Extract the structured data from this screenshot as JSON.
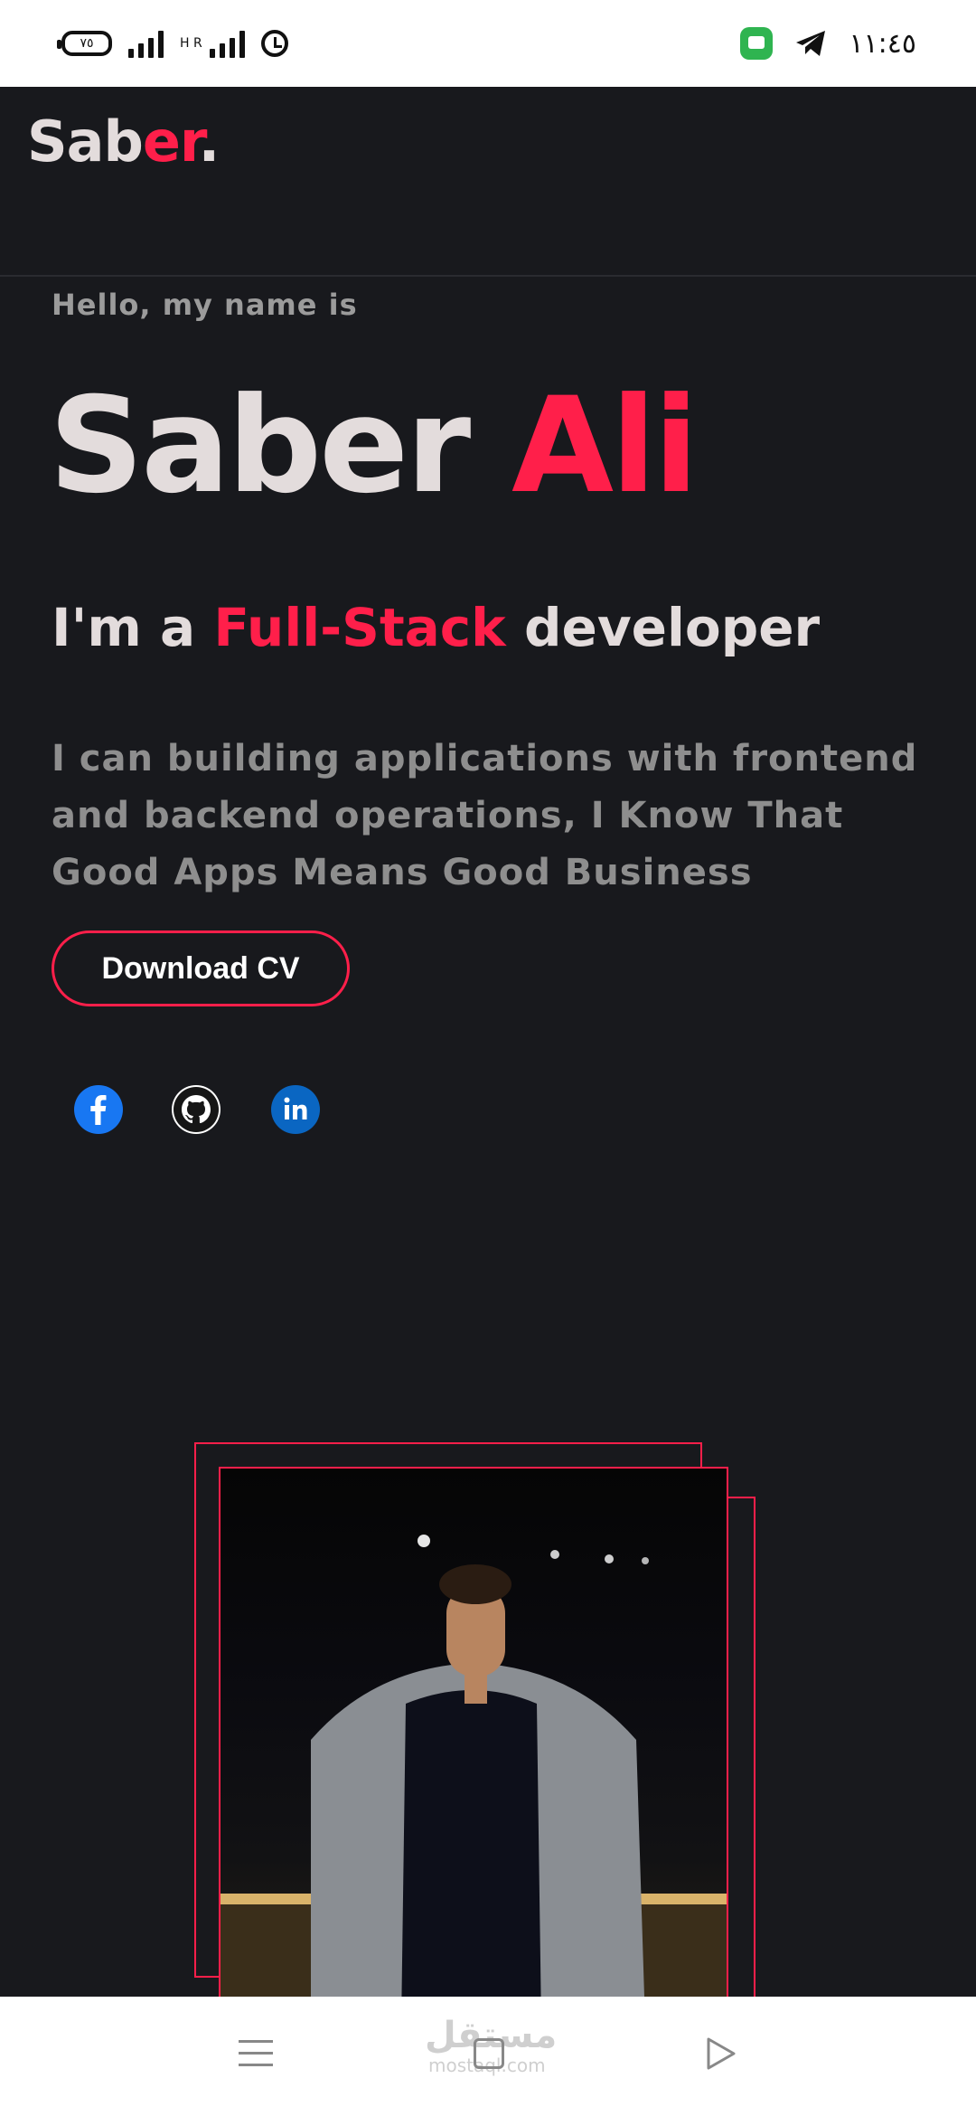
{
  "status_bar": {
    "battery": "٧٥",
    "network_type": "H R",
    "time": "١١:٤٥",
    "icons": [
      "battery-icon",
      "signal-icon",
      "signal-icon",
      "alarm-icon",
      "messages-app-icon",
      "telegram-icon"
    ]
  },
  "header": {
    "logo_main": "Sab",
    "logo_accent": "er",
    "logo_dot": "."
  },
  "hero": {
    "greeting": "Hello, my name is",
    "first_name": "Saber",
    "last_name": "Ali",
    "role_prefix": "I'm a",
    "role_highlight": "Full-Stack",
    "role_suffix": "developer",
    "description": "I can building applications with frontend and backend operations, I Know That Good Apps Means Good Business",
    "cv_button": "Download CV"
  },
  "social": [
    "facebook-icon",
    "github-icon",
    "linkedin-icon"
  ],
  "colors": {
    "background": "#18191d",
    "accent": "#ff1f4a",
    "text": "#e3dcdc",
    "muted": "#8e8e8e"
  },
  "nav_bar": {
    "watermark": "مستقل",
    "watermark_sub": "mostaql.com",
    "icons": [
      "menu-icon",
      "home-icon",
      "back-icon"
    ]
  }
}
